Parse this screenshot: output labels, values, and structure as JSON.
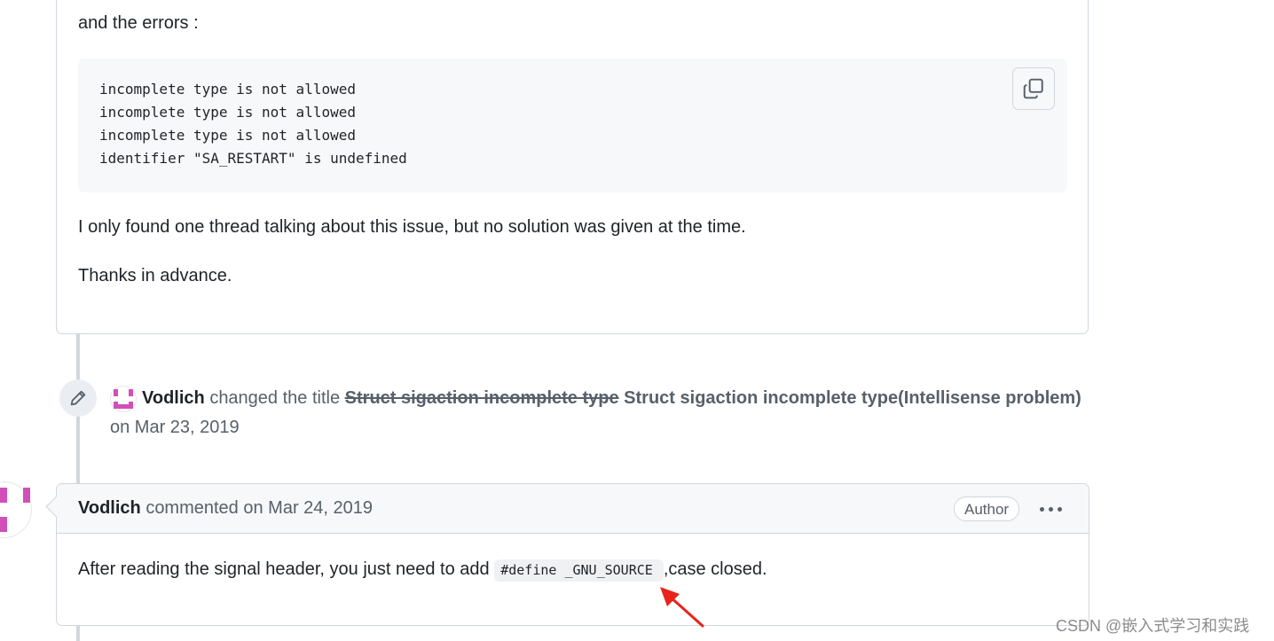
{
  "issue_body": {
    "errors_intro": "and the errors :",
    "code_lines": [
      "incomplete type is not allowed",
      "incomplete type is not allowed",
      "incomplete type is not allowed",
      "identifier \"SA_RESTART\" is undefined"
    ],
    "paragraph_1": "I only found one thread talking about this issue, but no solution was given at the time.",
    "paragraph_2": "Thanks in advance."
  },
  "title_change_event": {
    "user": "Vodlich",
    "action": "changed the title",
    "old_title": "Struct sigaction incomplete type",
    "new_title": "Struct sigaction incomplete type(Intellisense problem)",
    "date": "on Mar 23, 2019",
    "icon": "pencil-icon"
  },
  "comment": {
    "author": "Vodlich",
    "meta": "commented on Mar 24, 2019",
    "badge": "Author",
    "body_before": "After reading the signal header, you just need to add ",
    "body_code": "#define _GNU_SOURCE",
    "body_after": ",case closed."
  },
  "colors": {
    "avatar_pink": "#d14fb8",
    "annotation_red": "#e8231b"
  },
  "watermark": "CSDN @嵌入式学习和实践"
}
